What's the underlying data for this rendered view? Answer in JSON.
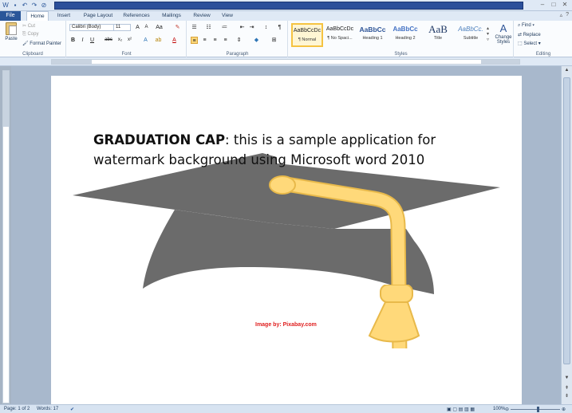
{
  "window": {
    "qat_icons": [
      "word-icon",
      "save-icon",
      "undo-icon",
      "redo-icon",
      "new-icon"
    ],
    "controls": [
      "minimize-icon",
      "maximize-icon",
      "close-icon"
    ]
  },
  "tabs": [
    {
      "label": "File"
    },
    {
      "label": "Home"
    },
    {
      "label": "Insert"
    },
    {
      "label": "Page Layout"
    },
    {
      "label": "References"
    },
    {
      "label": "Mailings"
    },
    {
      "label": "Review"
    },
    {
      "label": "View"
    }
  ],
  "ribbon": {
    "clipboard": {
      "paste": "Paste",
      "cut": "Cut",
      "copy": "Copy",
      "format_painter": "Format Painter",
      "label": "Clipboard"
    },
    "font": {
      "name": "Calibri (Body)",
      "size": "11",
      "label": "Font",
      "bold": "B",
      "italic": "I",
      "underline": "U",
      "strike": "abc"
    },
    "paragraph": {
      "label": "Paragraph",
      "pilcrow": "¶"
    },
    "styles": {
      "label": "Styles",
      "items": [
        {
          "sample": "AaBbCcDc",
          "name": "¶ Normal"
        },
        {
          "sample": "AaBbCcDc",
          "name": "¶ No Spaci..."
        },
        {
          "sample": "AaBbCc",
          "name": "Heading 1"
        },
        {
          "sample": "AaBbCc",
          "name": "Heading 2"
        },
        {
          "sample": "AaB",
          "name": "Title"
        },
        {
          "sample": "AaBbCc.",
          "name": "Subtitle"
        }
      ],
      "change_styles": "Change Styles"
    },
    "editing": {
      "label": "Editing",
      "find": "Find",
      "replace": "Replace",
      "select": "Select"
    }
  },
  "document": {
    "heading_bold": "GRADUATION CAP",
    "body_text": ": this is a sample application for watermark background using Microsoft word 2010",
    "credit": "Image by: Pixabay.com"
  },
  "status": {
    "page": "Page: 1 of 2",
    "words": "Words: 17",
    "zoom": "100%"
  },
  "colors": {
    "cap": "#6b6b6b",
    "tassel": "#ffd97a",
    "tassel_outline": "#e8b94a",
    "file_tab": "#2a5699"
  }
}
